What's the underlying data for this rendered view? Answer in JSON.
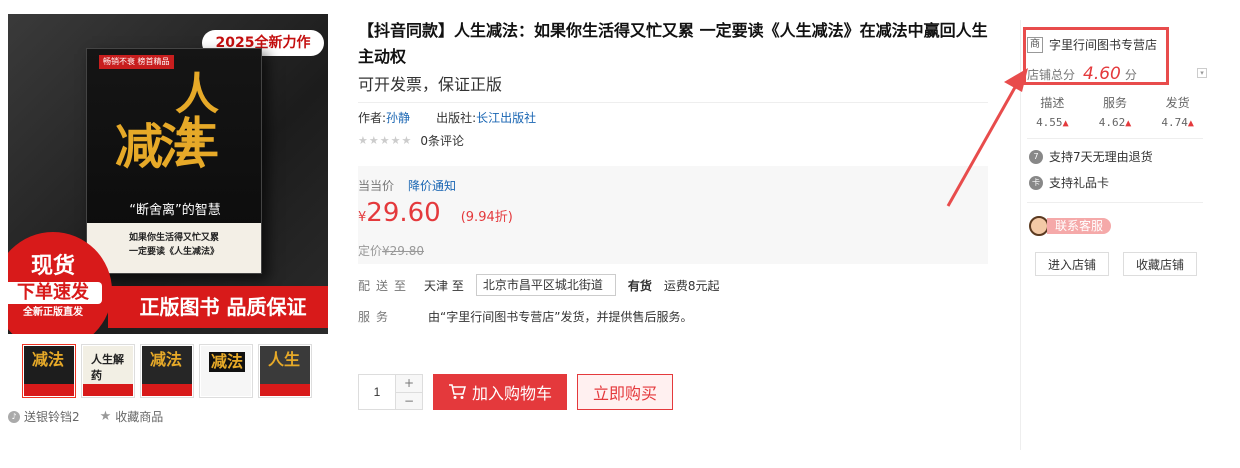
{
  "gallery": {
    "main_image": {
      "top_tag": "2025全新力作",
      "small_tag": "畅销不衰 榜首精品",
      "title_a": "减法",
      "title_b": "人生",
      "quote": "“断舍离”的智慧",
      "band_line1": "如果你生活得又忙又累",
      "band_line2": "一定要读《人生减法》",
      "circle_line1": "现货",
      "circle_line2": "下单速发",
      "circle_line3": "全新正版直发",
      "bottom_banner": "正版图书 品质保证"
    },
    "thumbnails": [
      {
        "label": "减法"
      },
      {
        "label": "人生解药"
      },
      {
        "label": "减法"
      },
      {
        "label": "减法"
      },
      {
        "label": "人生"
      }
    ],
    "actions": {
      "gift": "送银铃铛2",
      "favorite": "收藏商品"
    }
  },
  "product": {
    "title": "【抖音同款】人生减法：如果你生活得又忙又累 一定要读《人生减法》在减法中赢回人生主动权",
    "subtitle": "可开发票，保证正版",
    "author_label": "作者:",
    "author": "孙静",
    "publisher_label": "出版社:",
    "publisher": "长江出版社",
    "stars": "★★★★★",
    "comments": "0条评论"
  },
  "price": {
    "label": "当当价",
    "alert": "降价通知",
    "currency": "¥",
    "value": "29.60",
    "discount": "(9.94折)",
    "list_label": "定价",
    "list_value": "¥29.80"
  },
  "delivery": {
    "label": "配送至",
    "from": "天津 至",
    "address": "北京市昌平区城北街道",
    "stock": "有货",
    "shipping": "运费8元起"
  },
  "service": {
    "label": "服务",
    "text": "由“字里行间图书专营店”发货，并提供售后服务。"
  },
  "purchase": {
    "quantity": "1",
    "plus": "+",
    "minus": "−",
    "add_to_cart": "加入购物车",
    "buy_now": "立即购买"
  },
  "shop": {
    "icon_text": "商",
    "name": "字里行间图书专营店",
    "score_label": "店铺总分",
    "score": "4.60",
    "score_unit": "分",
    "ratings": [
      {
        "label": "描述",
        "value": "4.55"
      },
      {
        "label": "服务",
        "value": "4.62"
      },
      {
        "label": "发货",
        "value": "4.74"
      }
    ],
    "services": [
      {
        "icon": "7",
        "text": "支持7天无理由退货"
      },
      {
        "icon": "卡",
        "text": "支持礼品卡"
      }
    ],
    "contact": "联系客服",
    "enter": "进入店铺",
    "collect": "收藏店铺"
  },
  "colors": {
    "accent": "#e4393c",
    "link": "#1a66b3",
    "annotation": "#e84c4c"
  }
}
